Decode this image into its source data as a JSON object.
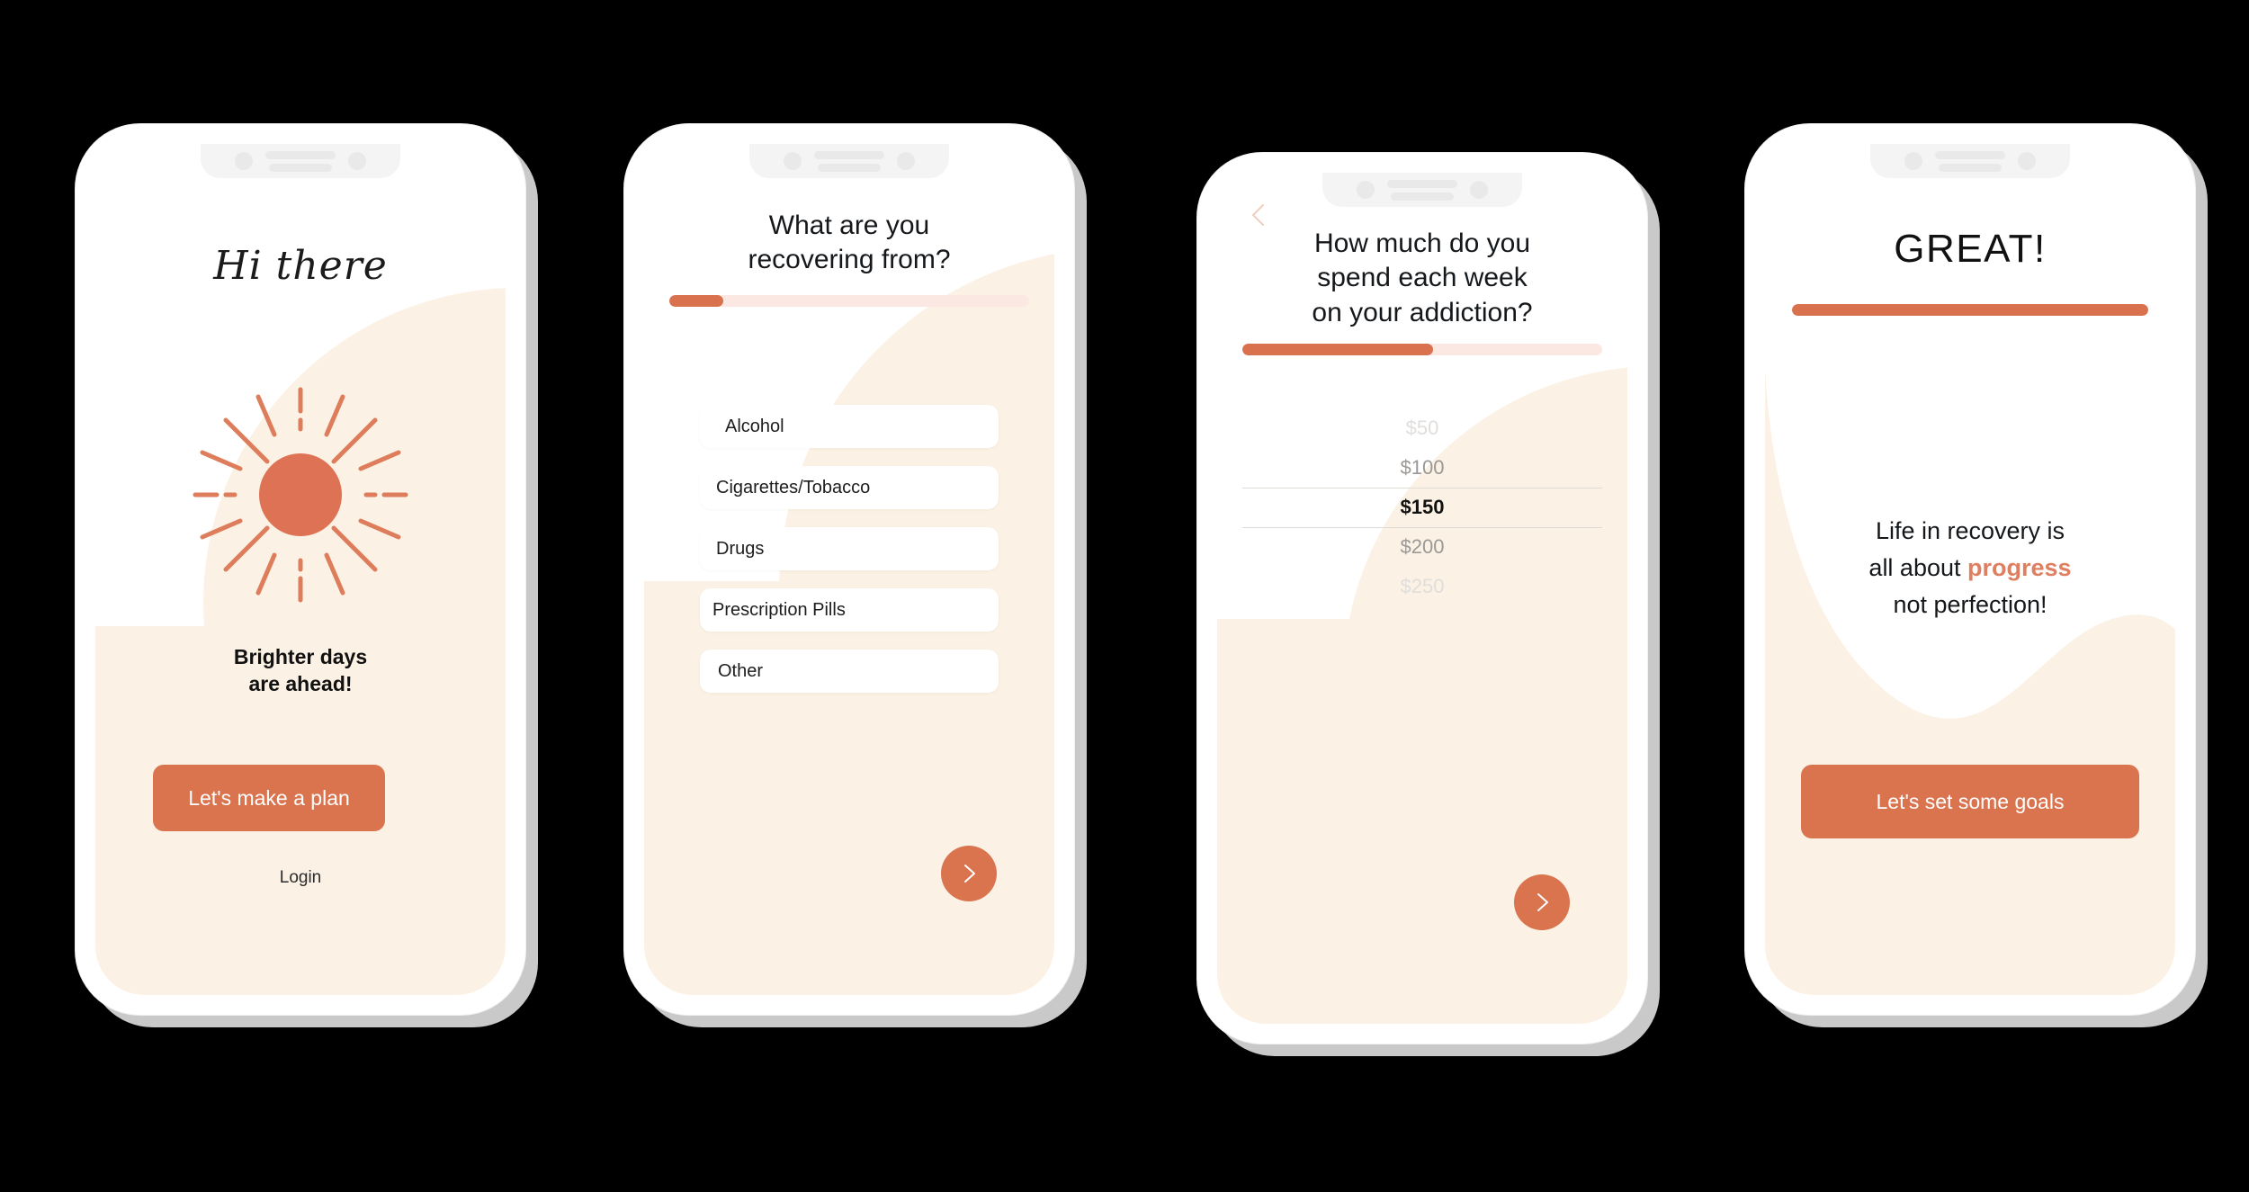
{
  "theme": {
    "accent": "#d9744f",
    "accent_light": "#df7f61",
    "cream": "#fbf1e4",
    "track": "#fbe8e2",
    "text_dark": "#15181b",
    "frame": "#ffffff",
    "frame_shadow": "#c9c9c9",
    "canvas": "#000000"
  },
  "screens": [
    {
      "id": "welcome",
      "name": "welcome-screen",
      "script_title": "Hi there",
      "sun_icon": "sun-icon",
      "tagline_line1": "Brighter days",
      "tagline_line2": "are ahead!",
      "cta_label": "Let's make a plan",
      "login_label": "Login"
    },
    {
      "id": "recovering-from",
      "name": "recovery-question-screen",
      "title_line1": "What are you",
      "title_line2": "recovering from?",
      "progress_percent": 15,
      "options": [
        {
          "label": "Alcohol",
          "indent": 28
        },
        {
          "label": "Cigarettes/Tobacco",
          "indent": 18
        },
        {
          "label": "Drugs",
          "indent": 18
        },
        {
          "label": "Prescription Pills",
          "indent": 14
        },
        {
          "label": "Other",
          "indent": 20
        }
      ],
      "next_icon": "chevron-right-icon"
    },
    {
      "id": "weekly-spend",
      "name": "spend-question-screen",
      "back_icon": "chevron-left-icon",
      "title_line1": "How much do you",
      "title_line2": "spend each week",
      "title_line3": "on your addiction?",
      "progress_percent": 53,
      "picker": {
        "name": "spend-amount-picker",
        "selected": "$150",
        "values": [
          "$50",
          "$100",
          "$150",
          "$200",
          "$250"
        ]
      },
      "next_icon": "chevron-right-icon"
    },
    {
      "id": "great",
      "name": "confirmation-screen",
      "title": "GREAT!",
      "progress_percent": 100,
      "body_line1": "Life in recovery is",
      "body_line2_prefix": "all about ",
      "body_line2_accent": "progress",
      "body_line3": "not perfection!",
      "cta_label": "Let's set some goals"
    }
  ]
}
